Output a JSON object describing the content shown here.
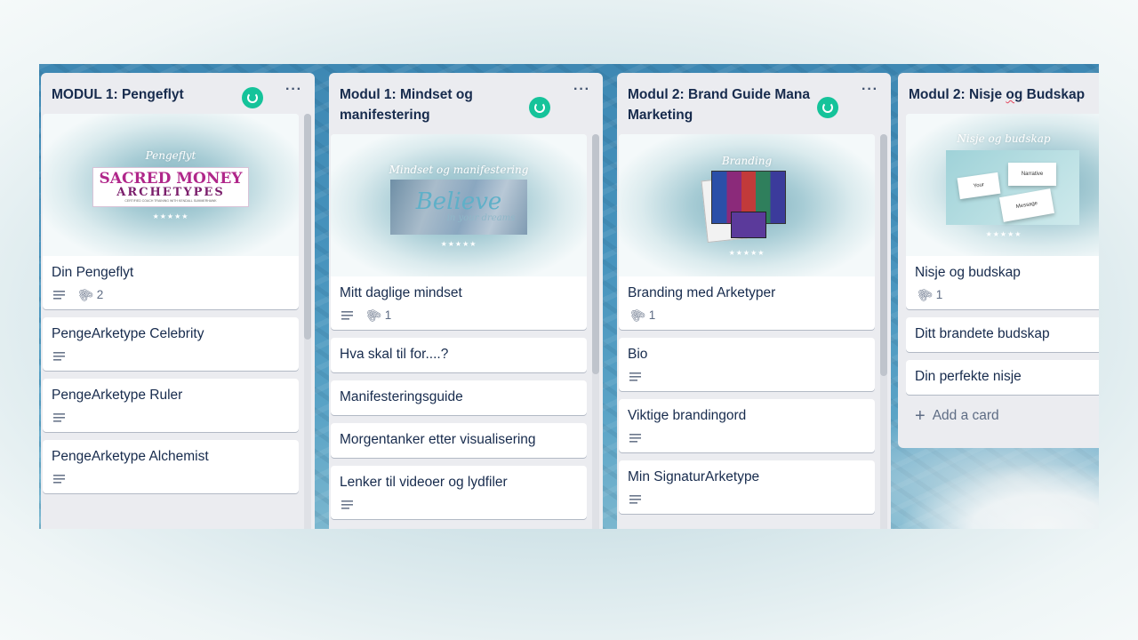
{
  "lists": [
    {
      "title": "MODUL 1: Pengeflyt",
      "cover": {
        "script": "Pengeflyt",
        "line1": "SACRED MONEY",
        "line2": "ARCHETYPES",
        "line3": "CERTIFIED COACH TRAINING WITH KENDALL SUMMERHAWK"
      },
      "cards": [
        {
          "title": "Din Pengeflyt",
          "attachments": "2"
        },
        {
          "title": "PengeArketype Celebrity"
        },
        {
          "title": "PengeArketype Ruler"
        },
        {
          "title": "PengeArketype Alchemist"
        }
      ]
    },
    {
      "title_line1": "Modul 1: Mindset og",
      "title_line2": "manifestering",
      "cover": {
        "script": "Mindset og manifestering",
        "word": "Believe",
        "sub": "in your dreams"
      },
      "cards": [
        {
          "title": "Mitt daglige mindset",
          "attachments": "1"
        },
        {
          "title": "Hva skal til for....?"
        },
        {
          "title": "Manifesteringsguide"
        },
        {
          "title": "Morgentanker etter visualisering"
        },
        {
          "title": "Lenker til videoer og lydfiler"
        }
      ]
    },
    {
      "title_line1": "Modul 2: Brand Guide Mana",
      "title_line2": "Marketing",
      "cover": {
        "script": "Branding"
      },
      "cards": [
        {
          "title": "Branding med Arketyper",
          "attachments": "1"
        },
        {
          "title": "Bio"
        },
        {
          "title": "Viktige brandingord"
        },
        {
          "title": "Min SignaturArketype"
        }
      ]
    },
    {
      "title_pre": "Modul 2: Nisje ",
      "title_err": "og",
      "title_post": " Budskap",
      "cover": {
        "script": "Nisje og budskap",
        "w1": "Your",
        "w2": "Narrative",
        "w3": "Message"
      },
      "cards": [
        {
          "title": "Nisje og budskap",
          "attachments": "1"
        },
        {
          "title": "Ditt brandete budskap"
        },
        {
          "title": "Din perfekte nisje"
        }
      ],
      "add_card": "Add a card"
    }
  ],
  "menu_glyph": "···",
  "stars": "★★★★★"
}
